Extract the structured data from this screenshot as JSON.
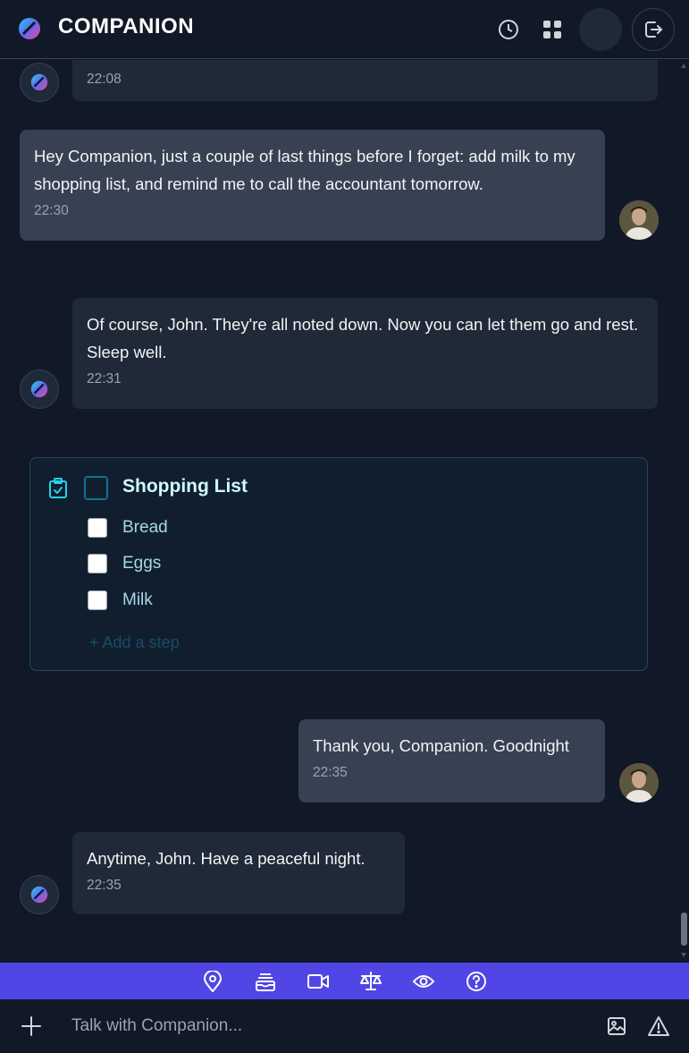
{
  "header": {
    "title": "COMPANION",
    "icons": [
      "history-icon",
      "apps-grid-icon",
      "voice-waveform-icon",
      "logout-icon"
    ]
  },
  "messages": [
    {
      "role": "bot",
      "text": "",
      "time": "22:08"
    },
    {
      "role": "user",
      "text": "Hey Companion, just a couple of last things before I forget: add milk to my shopping list, and remind me to call the accountant tomorrow.",
      "time": "22:30"
    },
    {
      "role": "bot",
      "text": "Of course, John. They're all noted down. Now you can let them go and rest. Sleep well.",
      "time": "22:31"
    },
    {
      "role": "user",
      "text": "Thank you, Companion. Goodnight",
      "time": "22:35"
    },
    {
      "role": "bot",
      "text": "Anytime, John. Have a peaceful night.",
      "time": "22:35"
    }
  ],
  "task": {
    "title": "Shopping List",
    "steps": [
      {
        "label": "Bread",
        "checked": false
      },
      {
        "label": "Eggs",
        "checked": false
      },
      {
        "label": "Milk",
        "checked": false
      }
    ],
    "add_step": "+ Add a step"
  },
  "toolbar": {
    "icons": [
      "location-pin-icon",
      "inbox-stack-icon",
      "video-camera-icon",
      "scales-icon",
      "eye-icon",
      "help-circle-icon"
    ]
  },
  "input": {
    "placeholder": "Talk with Companion..."
  },
  "colors": {
    "background": "#111827",
    "bot_bubble": "#1f2937",
    "user_bubble": "#374151",
    "toolbar": "#4f46e5",
    "task_accent": "#22d3ee"
  }
}
